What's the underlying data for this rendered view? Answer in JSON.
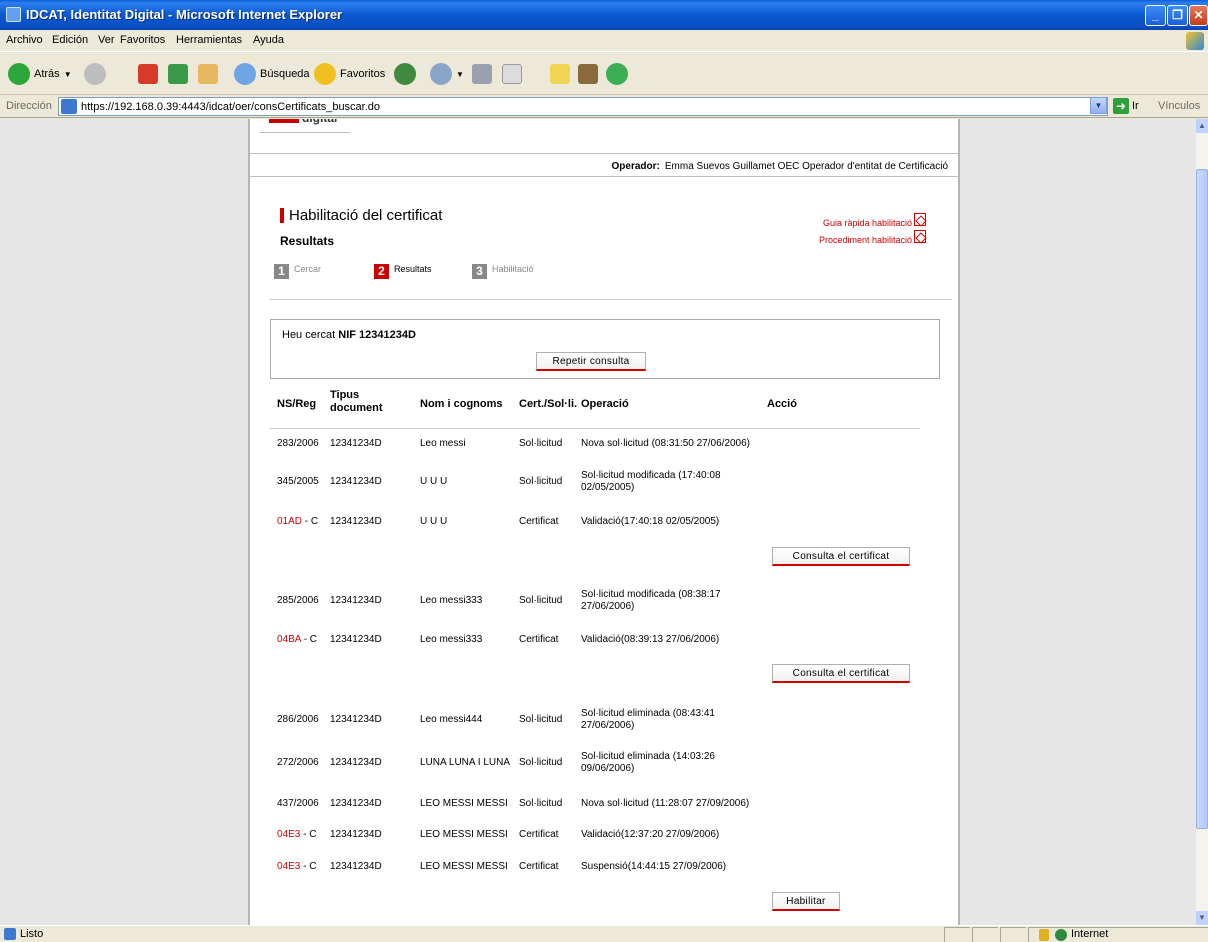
{
  "window": {
    "title": "IDCAT, Identitat Digital - Microsoft Internet Explorer"
  },
  "menu": [
    "Archivo",
    "Edición",
    "Ver",
    "Favoritos",
    "Herramientas",
    "Ayuda"
  ],
  "toolbar": {
    "back_label": "Atrás",
    "search_label": "Búsqueda",
    "favorites_label": "Favoritos"
  },
  "address": {
    "label": "Dirección",
    "url": "https://192.168.0.39:4443/idcat/oer/consCertificats_buscar.do",
    "go_label": "Ir",
    "links_label": "Vínculos"
  },
  "page": {
    "logo_word": "digital",
    "operator_label": "Operador:",
    "operator_value": "Emma Suevos Guillamet OEC  Operador d'entitat de Certificació",
    "title": "Habilitació del certificat",
    "subtitle": "Resultats",
    "guide_quick": "Guia ràpida habilitació",
    "guide_procedure": "Procediment habilitació",
    "steps": [
      {
        "num": "1",
        "label": "Cercar",
        "active": false
      },
      {
        "num": "2",
        "label": "Resultats",
        "active": true
      },
      {
        "num": "3",
        "label": "Habilitació",
        "active": false
      }
    ],
    "search_text_prefix": "Heu cercat",
    "search_text_value": "NIF 12341234D",
    "repeat_button": "Repetir consulta",
    "columns": {
      "ns": "NS/Reg",
      "type_line1": "Tipus",
      "type_line2": "document",
      "name": "Nom i cognoms",
      "cert": "Cert./Sol·li.",
      "operation": "Operació",
      "action": "Acció"
    },
    "rows": [
      {
        "ns": "283/2006",
        "ns_code": "",
        "doc": "12341234D",
        "name": "Leo messi",
        "kind": "Sol·licitud",
        "op1": "Nova sol·licitud (08:31:50 27/06/2006)",
        "op2": ""
      },
      {
        "ns": "345/2005",
        "ns_code": "",
        "doc": "12341234D",
        "name": "U U U",
        "kind": "Sol·licitud",
        "op1": "Sol·licitud modificada (17:40:08",
        "op2": "02/05/2005)"
      },
      {
        "ns": "- C",
        "ns_code": "01AD",
        "doc": "12341234D",
        "name": "U U U",
        "kind": "Certificat",
        "op1": "Validació(17:40:18 02/05/2005)",
        "op2": ""
      },
      {
        "ns": "285/2006",
        "ns_code": "",
        "doc": "12341234D",
        "name": "Leo messi333",
        "kind": "Sol·licitud",
        "op1": "Sol·licitud modificada (08:38:17",
        "op2": "27/06/2006)"
      },
      {
        "ns": "- C",
        "ns_code": "04BA",
        "doc": "12341234D",
        "name": "Leo messi333",
        "kind": "Certificat",
        "op1": "Validació(08:39:13 27/06/2006)",
        "op2": ""
      },
      {
        "ns": "286/2006",
        "ns_code": "",
        "doc": "12341234D",
        "name": "Leo messi444",
        "kind": "Sol·licitud",
        "op1": "Sol·licitud eliminada (08:43:41",
        "op2": "27/06/2006)"
      },
      {
        "ns": "272/2006",
        "ns_code": "",
        "doc": "12341234D",
        "name": "LUNA LUNA I LUNA",
        "kind": "Sol·licitud",
        "op1": "Sol·licitud eliminada (14:03:26",
        "op2": "09/06/2006)"
      },
      {
        "ns": "437/2006",
        "ns_code": "",
        "doc": "12341234D",
        "name": "LEO MESSI MESSI",
        "kind": "Sol·licitud",
        "op1": "Nova sol·licitud (11:28:07 27/09/2006)",
        "op2": ""
      },
      {
        "ns": "- C",
        "ns_code": "04E3",
        "doc": "12341234D",
        "name": "LEO MESSI MESSI",
        "kind": "Certificat",
        "op1": "Validació(12:37:20 27/09/2006)",
        "op2": ""
      },
      {
        "ns": "- C",
        "ns_code": "04E3",
        "doc": "12341234D",
        "name": "LEO MESSI MESSI",
        "kind": "Certificat",
        "op1": "Suspensió(14:44:15 27/09/2006)",
        "op2": ""
      }
    ],
    "consult_button": "Consulta el certificat",
    "enable_button": "Habilitar"
  },
  "status": {
    "left": "Listo",
    "zone": "Internet"
  },
  "colors": {
    "accent_red": "#cc0000",
    "xp_blue": "#0a5fd8"
  }
}
